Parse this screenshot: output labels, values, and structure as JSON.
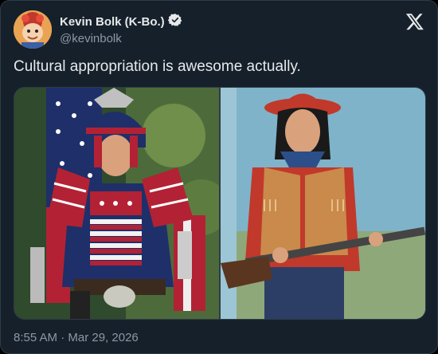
{
  "author": {
    "display_name": "Kevin Bolk (K-Bo.)",
    "handle": "@kevinbolk",
    "verified": true
  },
  "tweet": {
    "text": "Cultural appropriation is awesome actually.",
    "timestamp": "8:55 AM · Mar 29, 2026"
  },
  "media": [
    {
      "icon": "photo-samurai-armor-american-flag"
    },
    {
      "icon": "photo-child-cowboy-costume-rifle"
    }
  ],
  "colors": {
    "background": "#15202b",
    "text": "#e7e9ea",
    "muted": "#8b98a5",
    "verified_badge": "#e7e9ea"
  }
}
